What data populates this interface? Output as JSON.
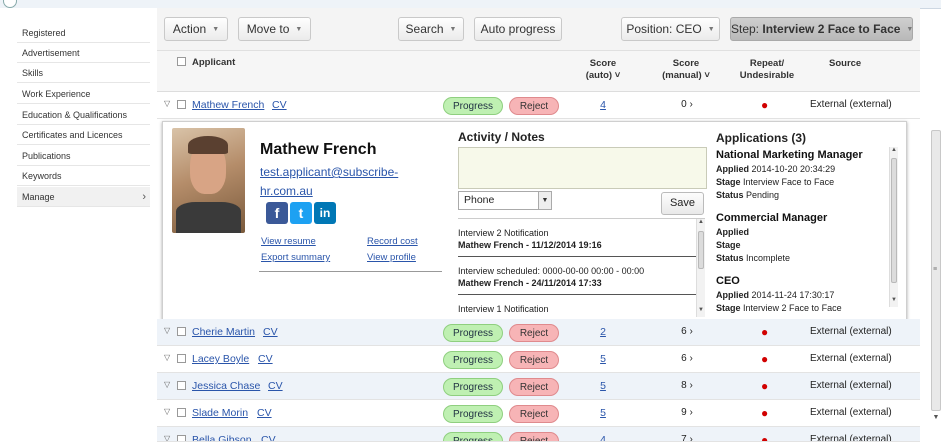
{
  "sidebar": {
    "items": [
      {
        "label": "Registered"
      },
      {
        "label": "Advertisement"
      },
      {
        "label": "Skills"
      },
      {
        "label": "Work Experience"
      },
      {
        "label": "Education & Qualifications"
      },
      {
        "label": "Certificates and Licences"
      },
      {
        "label": "Publications"
      },
      {
        "label": "Keywords"
      },
      {
        "label": "Manage"
      }
    ]
  },
  "toolbar": {
    "action": "Action",
    "move_to": "Move to",
    "search": "Search",
    "auto_progress": "Auto progress",
    "position": "Position: CEO",
    "step_prefix": "Step: ",
    "step_value": "Interview 2 Face to Face"
  },
  "table": {
    "headers": {
      "applicant": "Applicant",
      "score_auto_1": "Score",
      "score_auto_2": "(auto)",
      "score_manual_1": "Score",
      "score_manual_2": "(manual)",
      "repeat_1": "Repeat/",
      "repeat_2": "Undesirable",
      "source": "Source"
    },
    "progress_label": "Progress",
    "reject_label": "Reject",
    "cv_label": "CV",
    "rows": [
      {
        "name": "Mathew French",
        "score_auto": "4",
        "score_manual": "0",
        "source": "External (external)"
      },
      {
        "name": "Cherie Martin",
        "score_auto": "2",
        "score_manual": "6",
        "source": "External (external)"
      },
      {
        "name": "Lacey Boyle",
        "score_auto": "5",
        "score_manual": "6",
        "source": "External (external)"
      },
      {
        "name": "Jessica Chase",
        "score_auto": "5",
        "score_manual": "8",
        "source": "External (external)"
      },
      {
        "name": "Slade Morin",
        "score_auto": "5",
        "score_manual": "9",
        "source": "External (external)"
      },
      {
        "name": "Bella Gibson",
        "score_auto": "4",
        "score_manual": "7",
        "source": "External (external)"
      }
    ]
  },
  "detail": {
    "name": "Mathew French",
    "email": "test.applicant@subscribe-hr.com.au",
    "view_resume": "View resume",
    "record_cost": "Record cost",
    "export_summary": "Export summary",
    "view_profile": "View profile",
    "activity_title": "Activity / Notes",
    "note_type": "Phone",
    "save": "Save",
    "notes": [
      {
        "title": "Interview 2 Notification",
        "by": "Mathew French - 11/12/2014 19:16"
      },
      {
        "title": "Interview scheduled: 0000-00-00 00:00 - 00:00",
        "by": "Mathew French - 24/11/2014 17:33"
      },
      {
        "title": "Interview 1 Notification",
        "by": ""
      }
    ],
    "applications_title": "Applications (3)",
    "applications": [
      {
        "title": "National Marketing Manager",
        "applied_label": "Applied",
        "applied": "2014-10-20 20:34:29",
        "stage_label": "Stage",
        "stage": "Interview Face to Face",
        "status_label": "Status",
        "status": "Pending"
      },
      {
        "title": "Commercial Manager",
        "applied_label": "Applied",
        "applied": "",
        "stage_label": "Stage",
        "stage": "",
        "status_label": "Status",
        "status": "Incomplete"
      },
      {
        "title": "CEO",
        "applied_label": "Applied",
        "applied": "2014-11-24 17:30:17",
        "stage_label": "Stage",
        "stage": "Interview 2 Face to Face",
        "status_label": "",
        "status": ""
      }
    ]
  },
  "colors": {
    "link": "#2a55aa",
    "progress_bg": "#bff0b2",
    "reject_bg": "#f7b4b6",
    "undesirable_dot": "#d10000",
    "row_alt": "#eef3f9"
  },
  "icons": [
    "facebook-icon",
    "twitter-icon",
    "linkedin-icon",
    "chevron-right-icon",
    "expand-triangle-icon",
    "dropdown-caret-icon"
  ]
}
